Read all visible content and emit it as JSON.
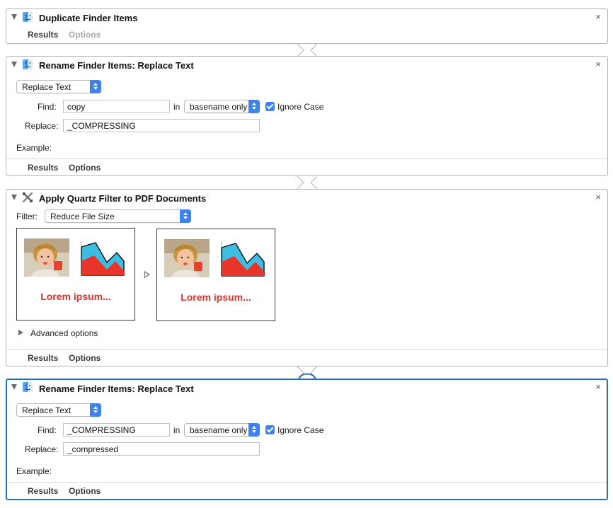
{
  "colors": {
    "accent": "#3d83ef",
    "selected_border": "#2b6cc0",
    "lorem_red": "#e0312a"
  },
  "actions": [
    {
      "title": "Duplicate Finder Items",
      "icon": "finder-icon",
      "close": "×",
      "tabs": {
        "results": "Results",
        "options": "Options"
      }
    },
    {
      "title": "Rename Finder Items: Replace Text",
      "icon": "finder-icon",
      "close": "×",
      "mode": "Replace Text",
      "find_label": "Find:",
      "find_value": "copy",
      "in_label": "in",
      "scope": "basename only",
      "ignore_case_label": "Ignore Case",
      "ignore_case_checked": true,
      "replace_label": "Replace:",
      "replace_value": "_COMPRESSING",
      "example_label": "Example:",
      "tabs": {
        "results": "Results",
        "options": "Options"
      }
    },
    {
      "title": "Apply Quartz Filter to PDF Documents",
      "icon": "quartz-tools-icon",
      "close": "×",
      "filter_label": "Filter:",
      "filter_value": "Reduce File Size",
      "preview_text": "Lorem ipsum...",
      "advanced_label": "Advanced options",
      "tabs": {
        "results": "Results",
        "options": "Options"
      }
    },
    {
      "title": "Rename Finder Items: Replace Text",
      "icon": "finder-icon",
      "close": "×",
      "mode": "Replace Text",
      "find_label": "Find:",
      "find_value": "_COMPRESSING",
      "in_label": "in",
      "scope": "basename only",
      "ignore_case_label": "Ignore Case",
      "ignore_case_checked": true,
      "replace_label": "Replace:",
      "replace_value": "_compressed",
      "example_label": "Example:",
      "tabs": {
        "results": "Results",
        "options": "Options"
      }
    }
  ]
}
